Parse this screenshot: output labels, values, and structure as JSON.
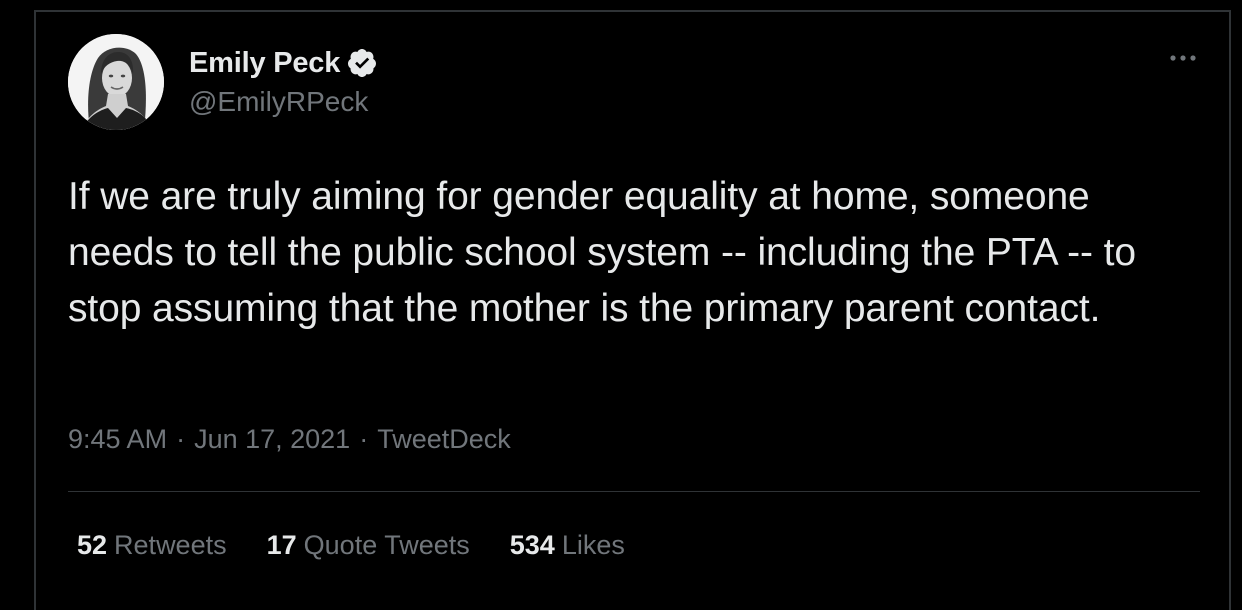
{
  "tweet": {
    "author": {
      "display_name": "Emily Peck",
      "handle": "@EmilyRPeck",
      "verified": true,
      "avatar_icon": "profile-photo"
    },
    "text": "If we are truly aiming for gender equality at home, someone needs to tell the public school system -- including the PTA -- to stop assuming that the mother is the primary parent contact.",
    "time": "9:45 AM",
    "date": "Jun 17, 2021",
    "source": "TweetDeck",
    "separator": "·",
    "more_icon": "ellipsis-icon",
    "stats": {
      "retweets_count": "52",
      "retweets_label": "Retweets",
      "quote_tweets_count": "17",
      "quote_tweets_label": "Quote Tweets",
      "likes_count": "534",
      "likes_label": "Likes"
    }
  },
  "colors": {
    "background": "#000000",
    "text_primary": "#e7e9ea",
    "text_secondary": "#71767b",
    "border": "#2f3336",
    "verified_badge": "#e7e9ea"
  }
}
